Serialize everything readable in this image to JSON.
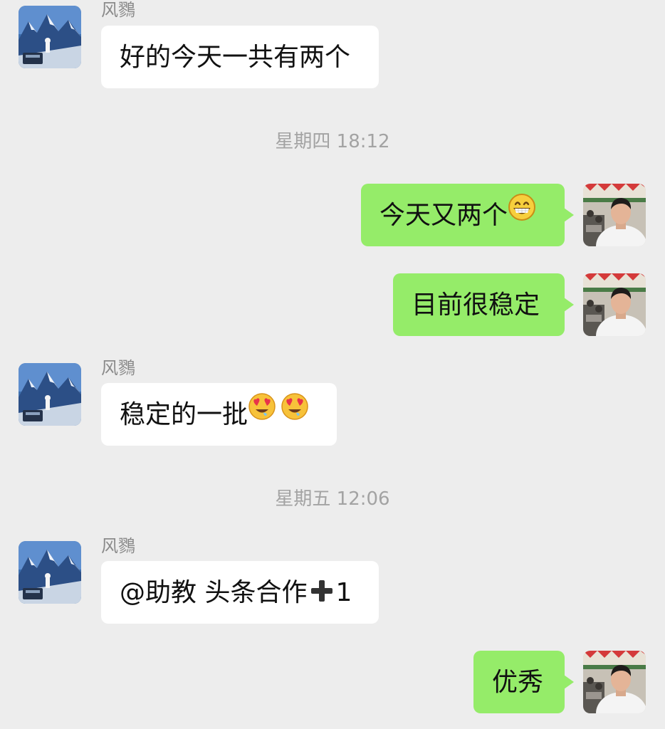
{
  "contact": {
    "name": "风鷚"
  },
  "messages": {
    "m1": {
      "sender": "风鷚",
      "text": "好的今天一共有两个"
    },
    "ts1": "星期四 18:12",
    "m2": {
      "text": "今天又两个",
      "emoji": "grinning-face-emoji"
    },
    "m3": {
      "text": "目前很稳定"
    },
    "m4": {
      "sender": "风鷚",
      "text": "稳定的一批",
      "emoji": "drooling-heart-eyes-emoji"
    },
    "ts2": "星期五 12:06",
    "m5": {
      "sender": "风鷚",
      "text_a": "@助教 头条合作",
      "emoji": "heavy-plus-icon",
      "text_b": "1"
    },
    "m6": {
      "text": "优秀"
    }
  },
  "colors": {
    "background": "#ededed",
    "incoming_bubble": "#ffffff",
    "outgoing_bubble": "#95ec69",
    "sender_name": "#8a8a8a",
    "timestamp": "#a3a3a3"
  }
}
